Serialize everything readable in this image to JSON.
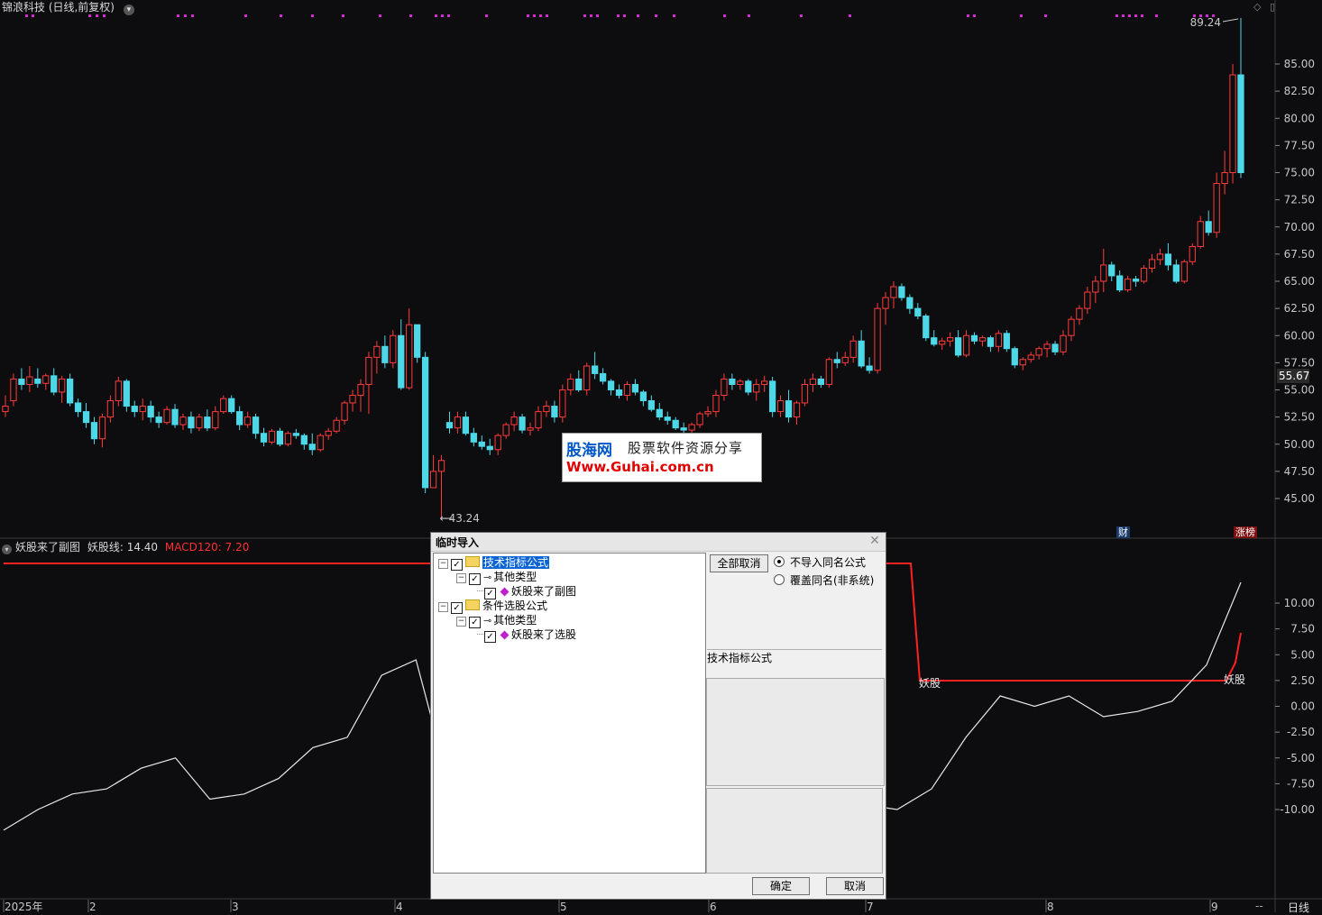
{
  "window": {
    "title": "锦浪科技 (日线,前复权)",
    "period": "日线",
    "period_dash": "--",
    "corner_icons": [
      "diamond-icon",
      "panel-icon"
    ]
  },
  "main_chart": {
    "price_axis": [
      "85.00",
      "82.50",
      "80.00",
      "77.50",
      "75.00",
      "72.50",
      "70.00",
      "67.50",
      "65.00",
      "62.50",
      "60.00",
      "57.50",
      "55.00",
      "52.50",
      "50.00",
      "47.50",
      "45.00"
    ],
    "last_price": "55.67",
    "high_marker": "89.24",
    "low_marker": "43.24",
    "badges": {
      "cai": "财",
      "zhangbang": "涨榜"
    },
    "colors": {
      "up": "#ff3b3b",
      "down": "#4dd8e8",
      "background": "#0d0d0f",
      "signal_dots": "#d22cd2"
    }
  },
  "sub_chart": {
    "name": "妖股来了副图",
    "line_label": "妖股线: 14.40",
    "macd_label": "MACD120: 7.20",
    "axis": [
      "10.00",
      "7.50",
      "5.00",
      "2.50",
      "0.00",
      "-2.50",
      "-5.00",
      "-7.50",
      "-10.00"
    ],
    "signal_labels": [
      "妖股",
      "妖股"
    ]
  },
  "date_axis": [
    "2025年",
    "2",
    "3",
    "4",
    "5",
    "6",
    "7",
    "8",
    "9"
  ],
  "watermark": {
    "brand": "股海网",
    "tagline": "股票软件资源分享",
    "url": "Www.Guhai.com.cn"
  },
  "dialog": {
    "title": "临时导入",
    "tree": [
      {
        "label": "技术指标公式",
        "checked": true
      },
      {
        "label": "其他类型",
        "checked": true
      },
      {
        "label": "妖股来了副图",
        "checked": true
      },
      {
        "label": "条件选股公式",
        "checked": true
      },
      {
        "label": "其他类型",
        "checked": true
      },
      {
        "label": "妖股来了选股",
        "checked": true
      }
    ],
    "cancel_all_label": "全部取消",
    "radio_options": [
      {
        "label": "不导入同名公式",
        "selected": true
      },
      {
        "label": "覆盖同名(非系统)",
        "selected": false
      }
    ],
    "info_label": "技术指标公式",
    "ok_label": "确定",
    "cancel_label": "取消"
  },
  "chart_data": {
    "type": "candlestick",
    "title": "锦浪科技 (日线,前复权)",
    "ylim": [
      43,
      90
    ],
    "series": [
      {
        "name": "K线",
        "note": "approx daily candles Jan–Sep 2025",
        "ohlc": [
          [
            53,
            54.5,
            52.5,
            53.5
          ],
          [
            54,
            56.5,
            53.5,
            56
          ],
          [
            56,
            57,
            55,
            55.5
          ],
          [
            55.5,
            57.2,
            54.8,
            56.2
          ],
          [
            56,
            57,
            55.2,
            55.6
          ],
          [
            55.6,
            56.5,
            55,
            56.3
          ],
          [
            56.3,
            57,
            54.5,
            54.8
          ],
          [
            54.8,
            56.3,
            53.8,
            56
          ],
          [
            56,
            56.5,
            53.5,
            53.8
          ],
          [
            53.8,
            54.2,
            52.5,
            53
          ],
          [
            53,
            53.8,
            51.5,
            52
          ],
          [
            52,
            52.5,
            50,
            50.5
          ],
          [
            50.5,
            52.8,
            49.7,
            52.5
          ],
          [
            52.5,
            54.5,
            52,
            54
          ],
          [
            54,
            56.2,
            53.5,
            55.8
          ],
          [
            55.8,
            56,
            53,
            53.5
          ],
          [
            53.5,
            54,
            52.5,
            53
          ],
          [
            53,
            54.2,
            52.2,
            53.5
          ],
          [
            53.5,
            54,
            52,
            52.5
          ],
          [
            52.5,
            53,
            51.5,
            52
          ],
          [
            52,
            53.5,
            51.8,
            53.2
          ],
          [
            53.2,
            53.7,
            51.5,
            51.8
          ],
          [
            51.8,
            52.8,
            51.3,
            52.5
          ],
          [
            52.5,
            53,
            51,
            51.5
          ],
          [
            51.5,
            52.8,
            51.2,
            52.5
          ],
          [
            52.5,
            53.2,
            51.2,
            51.5
          ],
          [
            51.5,
            53.5,
            51.3,
            53
          ],
          [
            53,
            54.5,
            52.8,
            54.2
          ],
          [
            54.2,
            54.5,
            52.8,
            53
          ],
          [
            53,
            53.5,
            51.3,
            51.8
          ],
          [
            51.8,
            53,
            51.5,
            52.5
          ],
          [
            52.5,
            52.8,
            50.5,
            51
          ],
          [
            51,
            51.5,
            49.8,
            50.2
          ],
          [
            50.2,
            51.4,
            50,
            51.2
          ],
          [
            51.2,
            51.5,
            49.8,
            50
          ],
          [
            50,
            51.2,
            49.8,
            51
          ],
          [
            51,
            51.4,
            50.5,
            50.8
          ],
          [
            50.8,
            51,
            49.5,
            50
          ],
          [
            50,
            51,
            49,
            49.5
          ],
          [
            49.5,
            51,
            49.3,
            50.8
          ],
          [
            50.8,
            51.5,
            50.4,
            51.2
          ],
          [
            51.2,
            52.5,
            51,
            52.2
          ],
          [
            52.2,
            54,
            51.8,
            53.8
          ],
          [
            53.8,
            55,
            53,
            54.5
          ],
          [
            54.5,
            56,
            53,
            55.5
          ],
          [
            55.5,
            58.5,
            52.8,
            58
          ],
          [
            58,
            59.5,
            56.5,
            59
          ],
          [
            59,
            60,
            57,
            57.5
          ],
          [
            57.5,
            60.5,
            57,
            60
          ],
          [
            60,
            61.5,
            55,
            55.2
          ],
          [
            55.2,
            62.5,
            55,
            61
          ],
          [
            61,
            60.5,
            57.5,
            58
          ],
          [
            58,
            58.5,
            45.5,
            46
          ],
          [
            46,
            49,
            46,
            47.5
          ],
          [
            47.5,
            49,
            43.2,
            48.5
          ],
          [
            52,
            53,
            51,
            51.5
          ],
          [
            51.5,
            53,
            51,
            52.5
          ],
          [
            52.5,
            53,
            50.8,
            51
          ],
          [
            51,
            51.5,
            49.8,
            50.2
          ],
          [
            50.2,
            50.8,
            49.5,
            49.8
          ],
          [
            49.8,
            50.5,
            49,
            49.5
          ],
          [
            49.5,
            51,
            49,
            50.8
          ],
          [
            50.8,
            52,
            50.5,
            51.8
          ],
          [
            51.8,
            53,
            51.2,
            52.5
          ],
          [
            52.5,
            52.8,
            51,
            51.3
          ],
          [
            51.3,
            52,
            50.8,
            51.5
          ],
          [
            51.5,
            53.5,
            51.2,
            53
          ],
          [
            53,
            54,
            52.5,
            53.5
          ],
          [
            53.5,
            54,
            52,
            52.5
          ],
          [
            52.5,
            55.5,
            52,
            55
          ],
          [
            55,
            56.5,
            54.5,
            56
          ],
          [
            56,
            56.8,
            54.8,
            55
          ],
          [
            55,
            57.5,
            54.5,
            57.2
          ],
          [
            57.2,
            58.5,
            56,
            56.5
          ],
          [
            56.5,
            57,
            55.5,
            55.8
          ],
          [
            55.8,
            56,
            54.5,
            55
          ],
          [
            55,
            55.5,
            54.2,
            54.5
          ],
          [
            54.5,
            55.8,
            54,
            55.5
          ],
          [
            55.5,
            56,
            54.5,
            54.8
          ],
          [
            54.8,
            55,
            53.5,
            54
          ],
          [
            54,
            54.5,
            53,
            53.2
          ],
          [
            53.2,
            53.8,
            52.2,
            52.5
          ],
          [
            52.5,
            53,
            51.8,
            52.2
          ],
          [
            52.2,
            52.5,
            51.3,
            51.5
          ],
          [
            51.5,
            52,
            51,
            51.3
          ],
          [
            51.3,
            52,
            50.8,
            51.8
          ],
          [
            51.8,
            53,
            51.5,
            52.8
          ],
          [
            52.8,
            53.5,
            52.5,
            53
          ],
          [
            53,
            55,
            52.5,
            54.5
          ],
          [
            54.5,
            56.5,
            54,
            56
          ],
          [
            56,
            56.5,
            55,
            55.5
          ],
          [
            55.5,
            56,
            55,
            55.8
          ],
          [
            55.8,
            56,
            54.5,
            54.8
          ],
          [
            54.8,
            56,
            54,
            55.5
          ],
          [
            55.5,
            56.3,
            54.8,
            55.8
          ],
          [
            55.8,
            56.2,
            52.5,
            53
          ],
          [
            53,
            54.5,
            52.5,
            54
          ],
          [
            54,
            55,
            52,
            52.5
          ],
          [
            52.5,
            54,
            51.8,
            53.8
          ],
          [
            53.8,
            56,
            53.5,
            55.5
          ],
          [
            55.5,
            56.5,
            54.8,
            56
          ],
          [
            56,
            56.3,
            55.2,
            55.5
          ],
          [
            55.5,
            58,
            55.2,
            57.8
          ],
          [
            57.8,
            58.5,
            57,
            57.5
          ],
          [
            57.5,
            58.5,
            57.2,
            58
          ],
          [
            58,
            60,
            57.5,
            59.5
          ],
          [
            59.5,
            60.5,
            57,
            57.2
          ],
          [
            57.2,
            58,
            56.5,
            56.8
          ],
          [
            56.8,
            63,
            56.5,
            62.5
          ],
          [
            62.5,
            64,
            61,
            63.5
          ],
          [
            63.5,
            65,
            62.5,
            64.5
          ],
          [
            64.5,
            64.8,
            63.2,
            63.5
          ],
          [
            63.5,
            63.8,
            62,
            62.5
          ],
          [
            62.5,
            63,
            61.5,
            61.8
          ],
          [
            61.8,
            62,
            59.5,
            59.8
          ],
          [
            59.8,
            60.5,
            59,
            59.2
          ],
          [
            59.2,
            59.8,
            58.7,
            59.5
          ],
          [
            59.5,
            60.3,
            59,
            59.8
          ],
          [
            59.8,
            60.5,
            58,
            58.2
          ],
          [
            58.2,
            60.5,
            58,
            60
          ],
          [
            60,
            60.3,
            59.2,
            59.5
          ],
          [
            59.5,
            60,
            59,
            59.8
          ],
          [
            59.8,
            60,
            58.5,
            59
          ],
          [
            59,
            60.5,
            58.5,
            60.2
          ],
          [
            60.2,
            60.5,
            58.5,
            58.8
          ],
          [
            58.8,
            59,
            57,
            57.3
          ],
          [
            57.3,
            58,
            56.8,
            57.8
          ],
          [
            57.8,
            58.5,
            57.5,
            58.2
          ],
          [
            58.2,
            59,
            57.8,
            58.8
          ],
          [
            58.8,
            59.5,
            58,
            59.2
          ],
          [
            59.2,
            59.5,
            58.2,
            58.5
          ],
          [
            58.5,
            60.5,
            58.2,
            60
          ],
          [
            60,
            61.8,
            59.5,
            61.5
          ],
          [
            61.5,
            62.8,
            61,
            62.5
          ],
          [
            62.5,
            64.5,
            62,
            64
          ],
          [
            64,
            65.5,
            63,
            65
          ],
          [
            65,
            68,
            64,
            66.5
          ],
          [
            66.5,
            66.8,
            65,
            65.5
          ],
          [
            65.5,
            66,
            64,
            64.2
          ],
          [
            64.2,
            65.5,
            64,
            65.2
          ],
          [
            65.2,
            65.5,
            64.5,
            65
          ],
          [
            65,
            66.5,
            64.8,
            66.2
          ],
          [
            66.2,
            67.5,
            65.8,
            67
          ],
          [
            67,
            68,
            66.5,
            67.5
          ],
          [
            67.5,
            68.5,
            66,
            66.5
          ],
          [
            66.5,
            67,
            64.8,
            65
          ],
          [
            65,
            67,
            64.8,
            66.8
          ],
          [
            66.8,
            68.5,
            66.5,
            68.2
          ],
          [
            68.2,
            71,
            68,
            70.5
          ],
          [
            70.5,
            71.5,
            69.2,
            69.5
          ],
          [
            69.5,
            75,
            69,
            74
          ],
          [
            74,
            77,
            73,
            75
          ],
          [
            75,
            85,
            74,
            84
          ],
          [
            84,
            89.24,
            74.5,
            75
          ]
        ]
      }
    ],
    "sub_series": [
      {
        "name": "妖股线",
        "values": [
          14.4,
          14.4,
          14.4,
          14.4,
          2.5,
          2.5,
          2.5,
          2.5,
          2.5,
          7.2
        ]
      },
      {
        "name": "MACD120",
        "approx_values": [
          -12,
          -10,
          -8.5,
          -8,
          -6,
          -5,
          -9,
          -8.5,
          -7,
          -4,
          -3,
          3,
          4.5,
          -8,
          -10,
          -12,
          -9,
          -3,
          3.5,
          5,
          2,
          0,
          -4,
          -6,
          -8,
          -9.5,
          -10,
          -8,
          -3,
          1,
          0,
          1,
          -1,
          -0.5,
          0.5,
          4,
          12
        ]
      }
    ],
    "price_axis_ticks": [
      85,
      82.5,
      80,
      77.5,
      75,
      72.5,
      70,
      67.5,
      65,
      62.5,
      60,
      57.5,
      55,
      52.5,
      50,
      47.5,
      45
    ],
    "x_labels": [
      "2025年",
      "2",
      "3",
      "4",
      "5",
      "6",
      "7",
      "8",
      "9"
    ]
  }
}
